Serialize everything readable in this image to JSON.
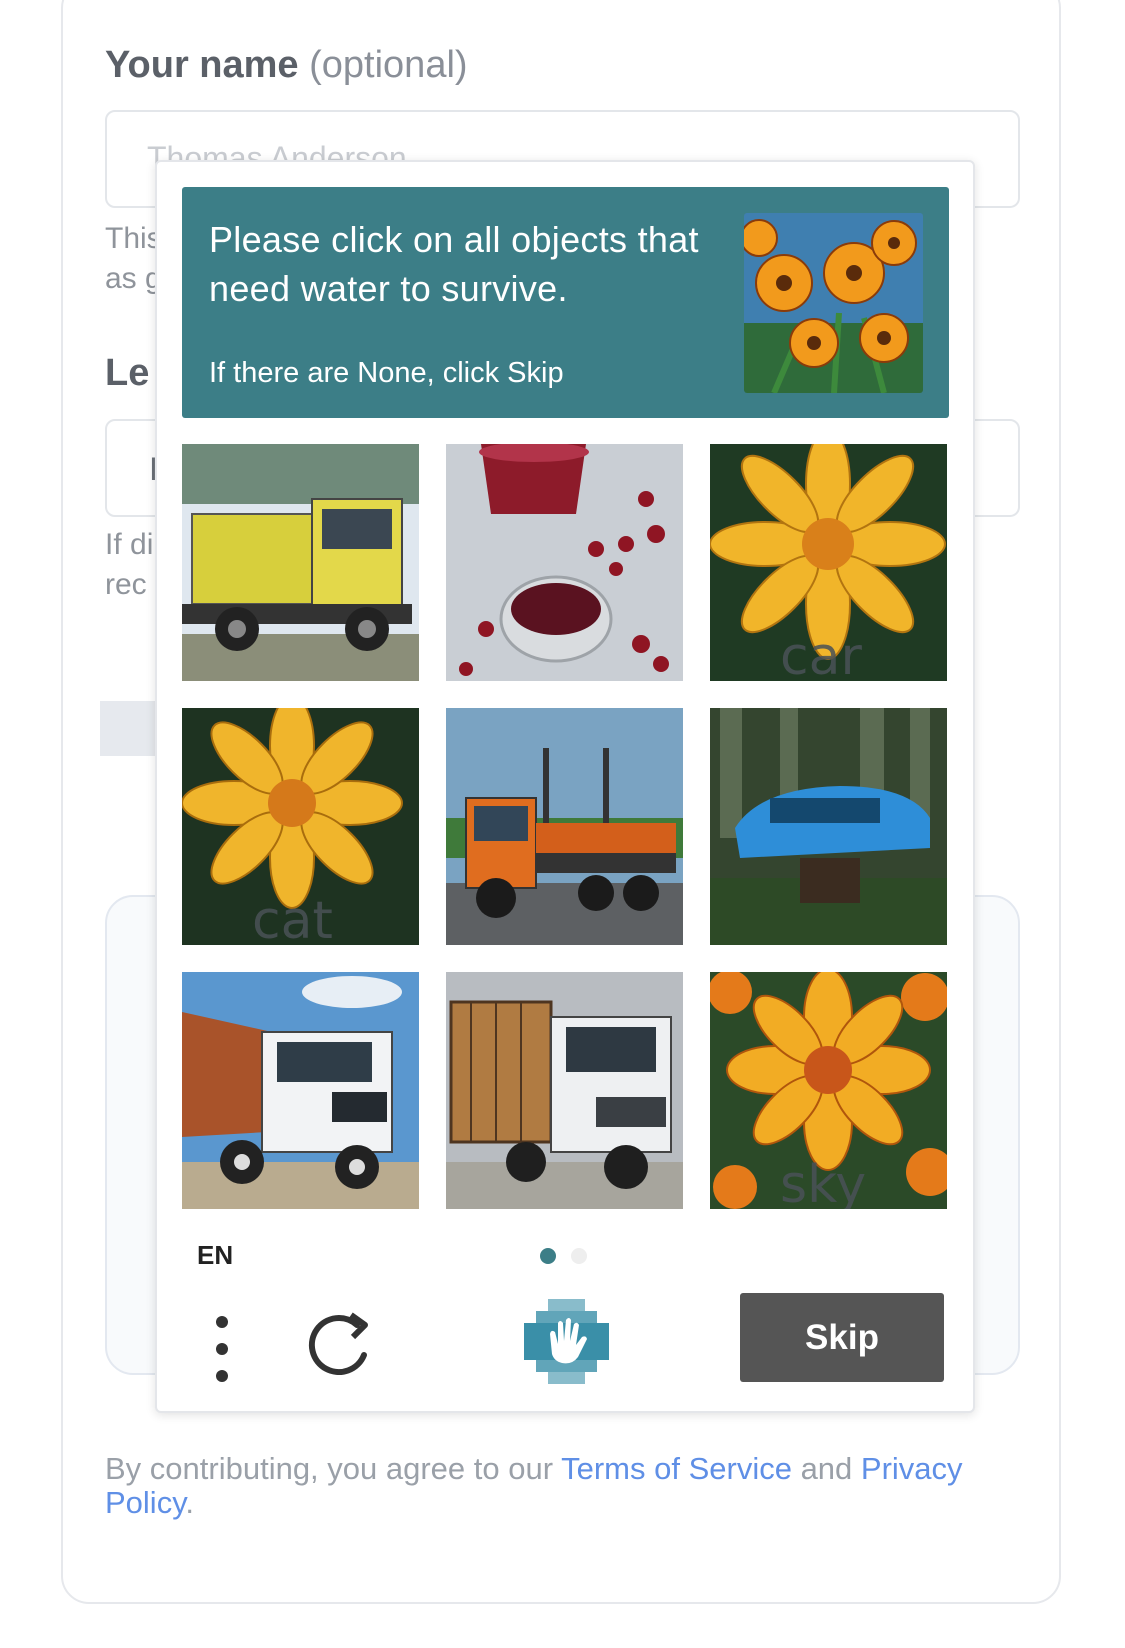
{
  "form": {
    "name_label": "Your name",
    "name_optional": "(optional)",
    "name_placeholder": "Thomas Anderson",
    "help_line1": "This",
    "help_line2": "as g",
    "second_label": "Le",
    "second_input_value": "I",
    "note_line1": "If di",
    "note_line2": "rec",
    "footer": {
      "prefix": "By contributing, you agree to our ",
      "terms": "Terms of Service",
      "middle": " and ",
      "privacy": "Privacy Policy",
      "suffix": "."
    }
  },
  "captcha": {
    "prompt": "Please click on all objects that need water to survive.",
    "sub": "If there are None, click Skip",
    "example_image": "orange-flowers-image",
    "tiles": [
      {
        "image": "yellow-dump-truck",
        "caption": ""
      },
      {
        "image": "juice-and-cherries",
        "caption": ""
      },
      {
        "image": "yellow-flower",
        "caption": "car"
      },
      {
        "image": "yellow-flower",
        "caption": "cat"
      },
      {
        "image": "orange-flatbed-truck",
        "caption": ""
      },
      {
        "image": "blue-blurred-car",
        "caption": ""
      },
      {
        "image": "white-dump-truck",
        "caption": ""
      },
      {
        "image": "white-cargo-truck",
        "caption": ""
      },
      {
        "image": "orange-flower",
        "caption": "sky"
      }
    ],
    "language": "EN",
    "page_active": 1,
    "page_count": 2,
    "skip_label": "Skip",
    "accent_color": "#3c7e87",
    "skip_color": "#555555"
  }
}
